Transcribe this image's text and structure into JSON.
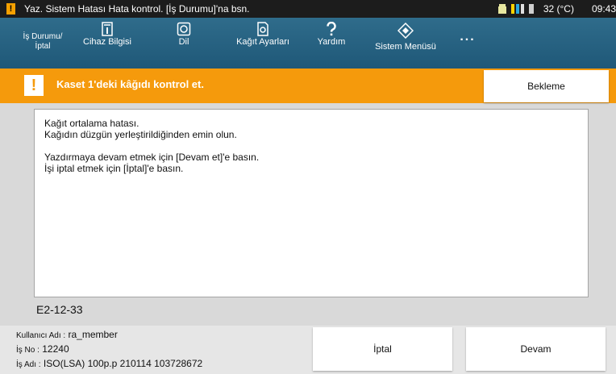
{
  "topbar": {
    "title": "Yaz. Sistem Hatası Hata kontrol. [İş Durumu]'na bsn.",
    "temperature": "32 (°C)",
    "time": "09:43",
    "icons": [
      "warning-icon",
      "printer-status-icon",
      "toner-level-icon",
      "battery-icon"
    ]
  },
  "nav": {
    "job_status": "İş Durumu/\nİptal",
    "device_info": "Cihaz Bilgisi",
    "language": "Dil",
    "paper_settings": "Kağıt Ayarları",
    "help": "Yardım",
    "system_menu": "Sistem Menüsü",
    "more": "..."
  },
  "alert": {
    "message": "Kaset 1'deki kâğıdı kontrol et.",
    "wait_button": "Bekleme"
  },
  "message_panel": {
    "lines1": [
      "Kağıt ortalama hatası.",
      "Kağıdın düzgün yerleştirildiğinden emin olun."
    ],
    "lines2": [
      "Yazdırmaya devam etmek için [Devam et]'e basın.",
      "İşi iptal etmek için [İptal]'e basın."
    ]
  },
  "error_code": "E2-12-33",
  "job_info": {
    "user_label": "Kullanıcı Adı :",
    "user_value": "ra_member",
    "job_no_label": "İş No :",
    "job_no_value": "12240",
    "job_name_label": "İş Adı :",
    "job_name_value": "ISO(LSA) 100p.p 210114 103728672"
  },
  "buttons": {
    "cancel": "İptal",
    "continue": "Devam"
  },
  "colors": {
    "alert": "#f59a0c",
    "nav": "#2a6787",
    "topbar": "#1c1c1c"
  }
}
